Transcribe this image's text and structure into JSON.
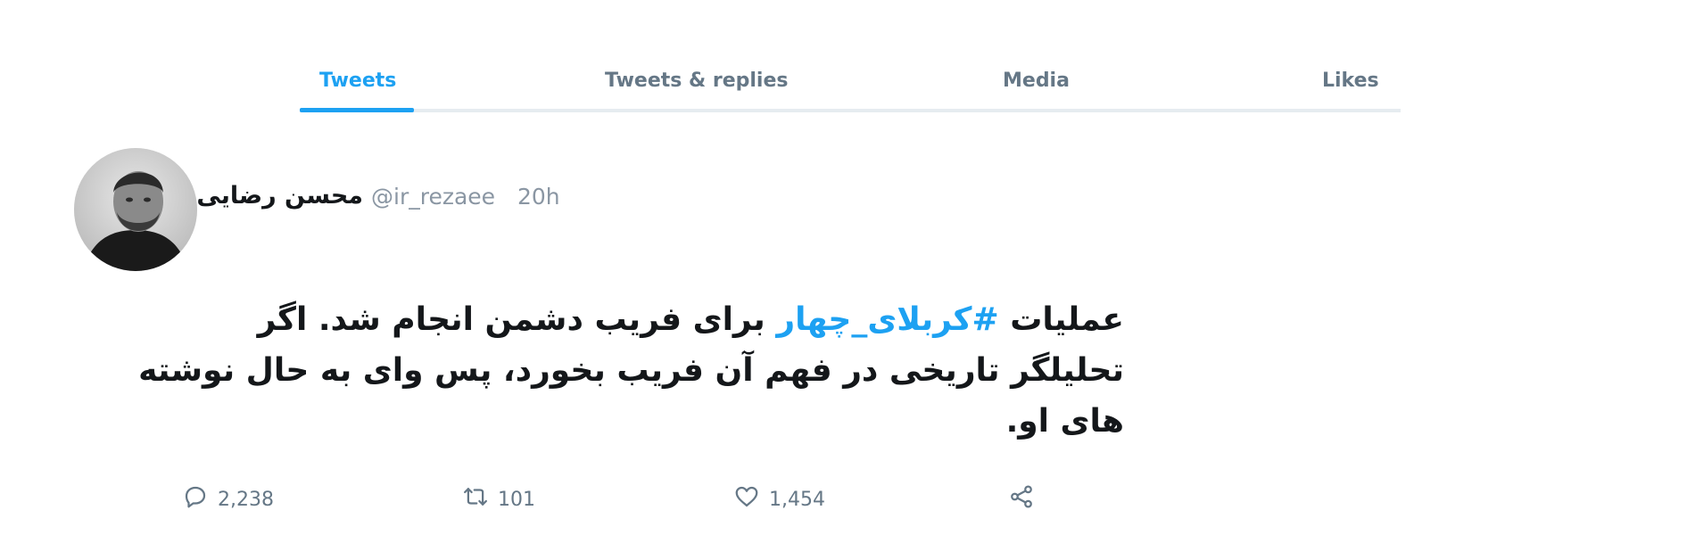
{
  "tabs": [
    {
      "label": "Tweets",
      "active": true
    },
    {
      "label": "Tweets & replies",
      "active": false
    },
    {
      "label": "Media",
      "active": false
    },
    {
      "label": "Likes",
      "active": false
    }
  ],
  "tweet": {
    "display_name": "محسن رضایی",
    "handle": "@ir_rezaee",
    "time": "20h",
    "text_prefix": "عملیات ",
    "hashtag": "#کربلای_چهار",
    "text_rest": " برای فریب دشمن انجام شد. اگر تحلیلگر تاریخی در فهم آن فریب بخورد، پس وای به حال نوشته های او.",
    "actions": {
      "replies": "2,238",
      "retweets": "101",
      "likes": "1,454"
    }
  },
  "colors": {
    "accent": "#1da1f2",
    "muted": "#657786"
  },
  "icons": [
    "reply-icon",
    "retweet-icon",
    "like-icon",
    "share-icon"
  ]
}
